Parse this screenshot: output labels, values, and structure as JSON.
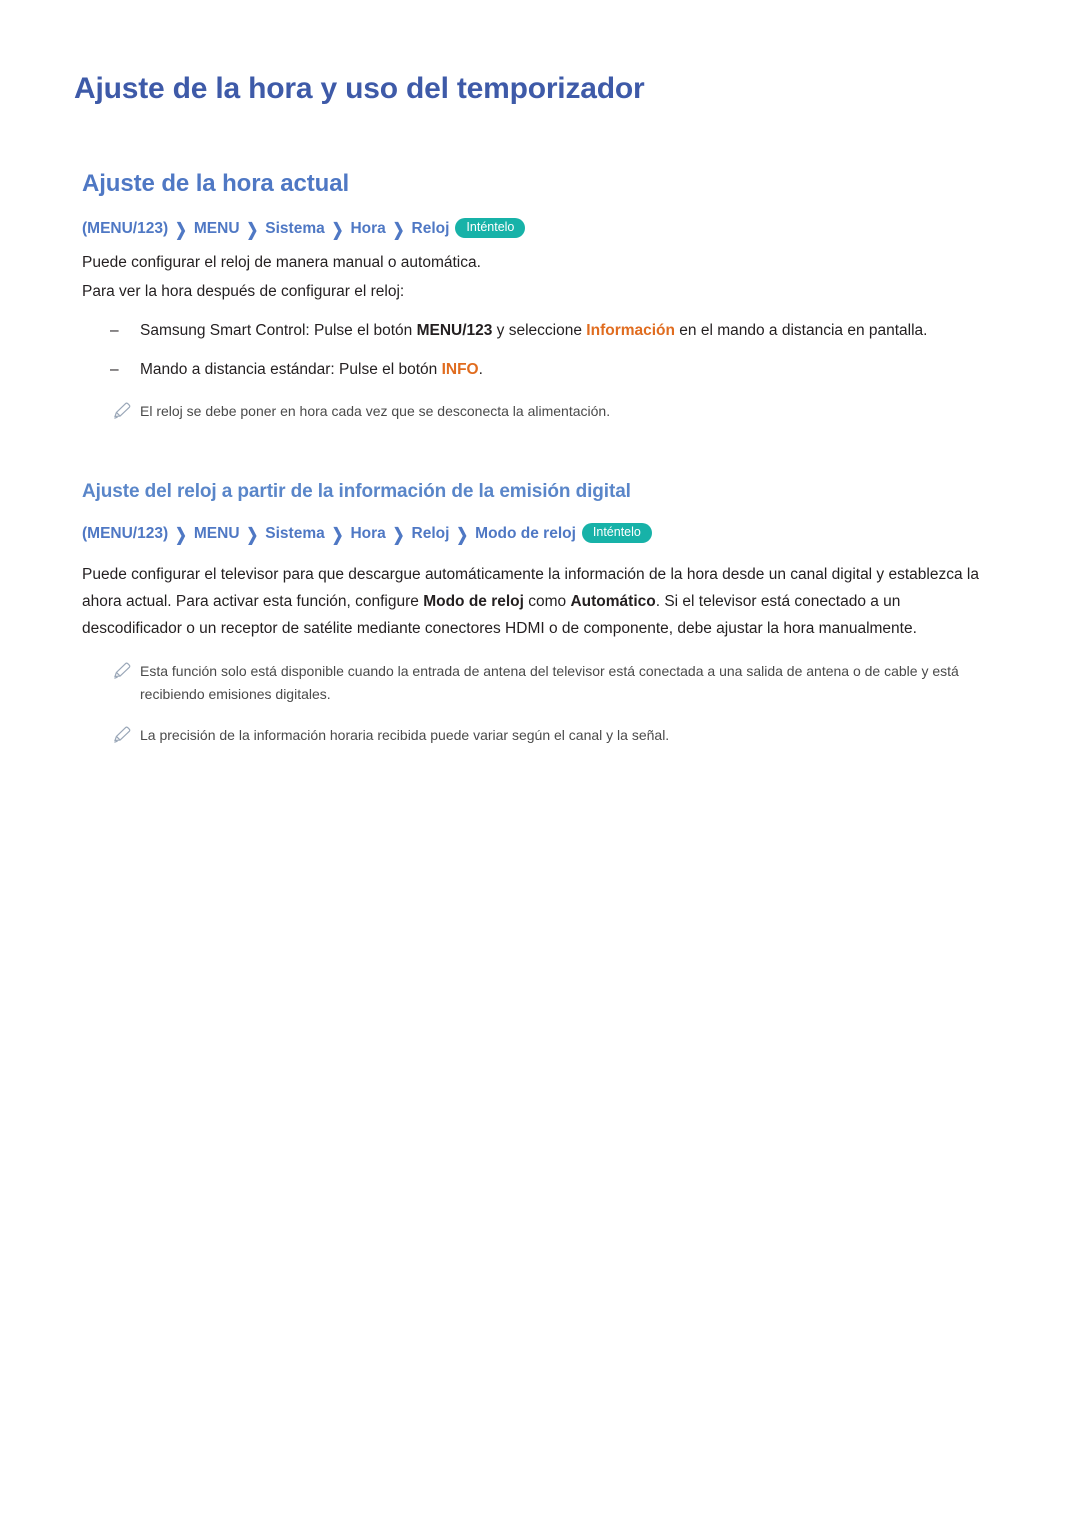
{
  "doc": {
    "title": "Ajuste de la hora y uso del temporizador",
    "section1": {
      "heading": "Ajuste de la hora actual",
      "breadcrumb": {
        "open_paren": "(",
        "items": [
          "MENU/123",
          "MENU",
          "Sistema",
          "Hora",
          "Reloj"
        ],
        "close_after": 0,
        "try_label": "Inténtelo"
      },
      "paragraph1": "Puede configurar el reloj de manera manual o automática.",
      "paragraph2": "Para ver la hora después de configurar el reloj:",
      "bullets": [
        {
          "dash": "–",
          "pre": "Samsung Smart Control: Pulse el botón ",
          "kw1": "MENU/123",
          "mid": " y seleccione ",
          "kw2": "Información",
          "post": " en el mando a distancia en pantalla."
        },
        {
          "dash": "–",
          "pre": "Mando a distancia estándar: Pulse el botón ",
          "kw1": "INFO",
          "mid": "",
          "kw2": "",
          "post": "."
        }
      ],
      "notes": [
        "El reloj se debe poner en hora cada vez que se desconecta la alimentación."
      ]
    },
    "section2": {
      "heading": "Ajuste del reloj a partir de la información de la emisión digital",
      "breadcrumb": {
        "open_paren": "(",
        "items": [
          "MENU/123",
          "MENU",
          "Sistema",
          "Hora",
          "Reloj",
          "Modo de reloj"
        ],
        "try_label": "Inténtelo"
      },
      "paragraph": {
        "part1": "Puede configurar el televisor para que descargue automáticamente la información de la hora desde un canal digital y establezca la ahora actual. Para activar esta función, configure ",
        "kw1": "Modo de reloj",
        "part2": " como ",
        "kw2": "Automático",
        "part3": ". Si el televisor está conectado a un descodificador o un receptor de satélite mediante conectores HDMI o de componente, debe ajustar la hora manualmente."
      },
      "notes": [
        "Esta función solo está disponible cuando la entrada de antena del televisor está conectada a una salida de antena o de cable y está recibiendo emisiones digitales.",
        "La precisión de la información horaria recibida puede variar según el canal y la señal."
      ]
    }
  },
  "colors": {
    "title_blue": "#3e5aa8",
    "heading_blue": "#4f78c4",
    "subheading_blue": "#5a86c9",
    "pill_teal": "#17b2a8",
    "keyword_orange": "#e06c1f",
    "body_text": "#231f20",
    "note_text": "#4a4a4a"
  }
}
